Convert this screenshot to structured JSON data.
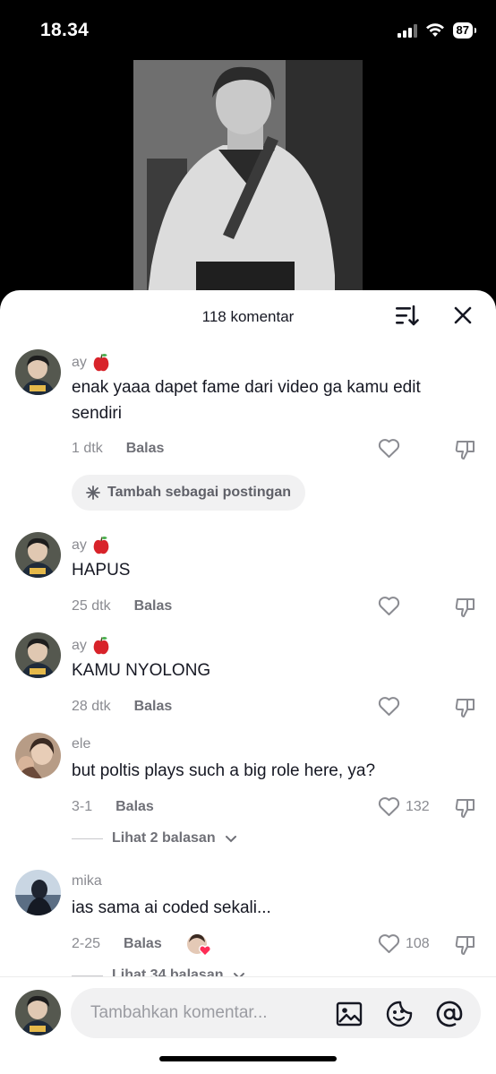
{
  "status_bar": {
    "time": "18.34",
    "battery": "87"
  },
  "sheet": {
    "comment_count_label": "118 komentar"
  },
  "comments": [
    {
      "username": "ay",
      "badge": "apple-emoji",
      "text": "enak yaaa dapet fame dari video ga kamu edit sendiri",
      "time": "1 dtk",
      "reply_label": "Balas",
      "likes": "",
      "chip_label": "Tambah sebagai postingan"
    },
    {
      "username": "ay",
      "badge": "apple-emoji",
      "text": "HAPUS",
      "time": "25 dtk",
      "reply_label": "Balas",
      "likes": ""
    },
    {
      "username": "ay",
      "badge": "apple-emoji",
      "text": "KAMU NYOLONG",
      "time": "28 dtk",
      "reply_label": "Balas",
      "likes": ""
    },
    {
      "username": "ele",
      "text": "but poltis plays such a big role here, ya?",
      "time": "3-1",
      "reply_label": "Balas",
      "likes": "132",
      "replies_label": "Lihat 2 balasan"
    },
    {
      "username": "mika",
      "text": "ias sama ai coded sekali...",
      "time": "2-25",
      "reply_label": "Balas",
      "likes": "108",
      "replies_label": "Lihat 34 balasan"
    }
  ],
  "input": {
    "placeholder": "Tambahkan komentar..."
  },
  "colors": {
    "accent_like": "#8a8b91",
    "apple": "#d8232a",
    "heart_badge": "#fe2c55"
  }
}
